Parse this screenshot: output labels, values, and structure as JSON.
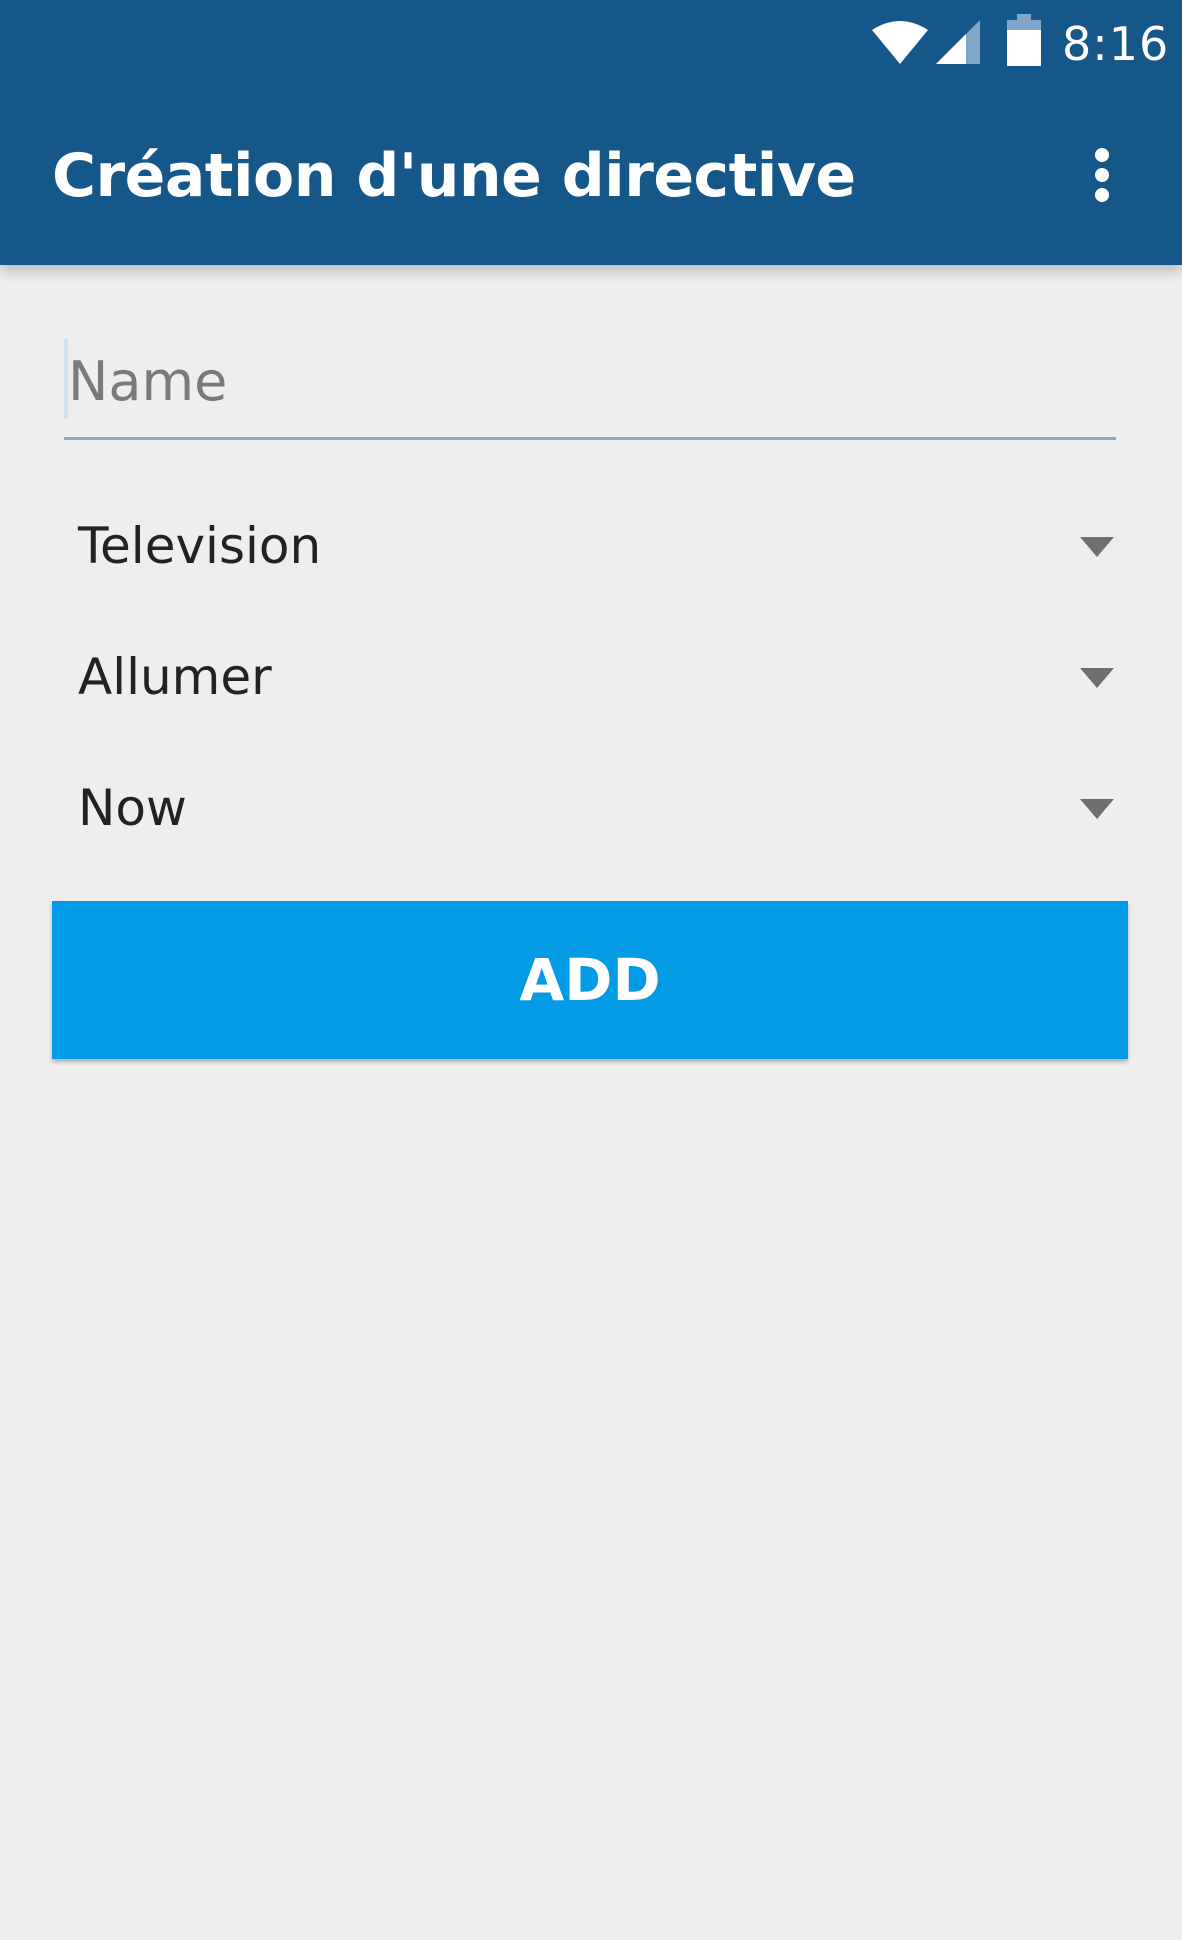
{
  "status_bar": {
    "time": "8:16",
    "icons": [
      "wifi-icon",
      "signal-icon",
      "battery-icon"
    ]
  },
  "app_bar": {
    "title": "Création d'une directive",
    "menu_icon": "more-vert-icon",
    "background_color": "#145788"
  },
  "form": {
    "name_placeholder": "Name",
    "name_value": "",
    "device_selected": "Television",
    "action_selected": "Allumer",
    "time_selected": "Now",
    "add_label": "ADD",
    "add_button_color": "#039be5"
  }
}
